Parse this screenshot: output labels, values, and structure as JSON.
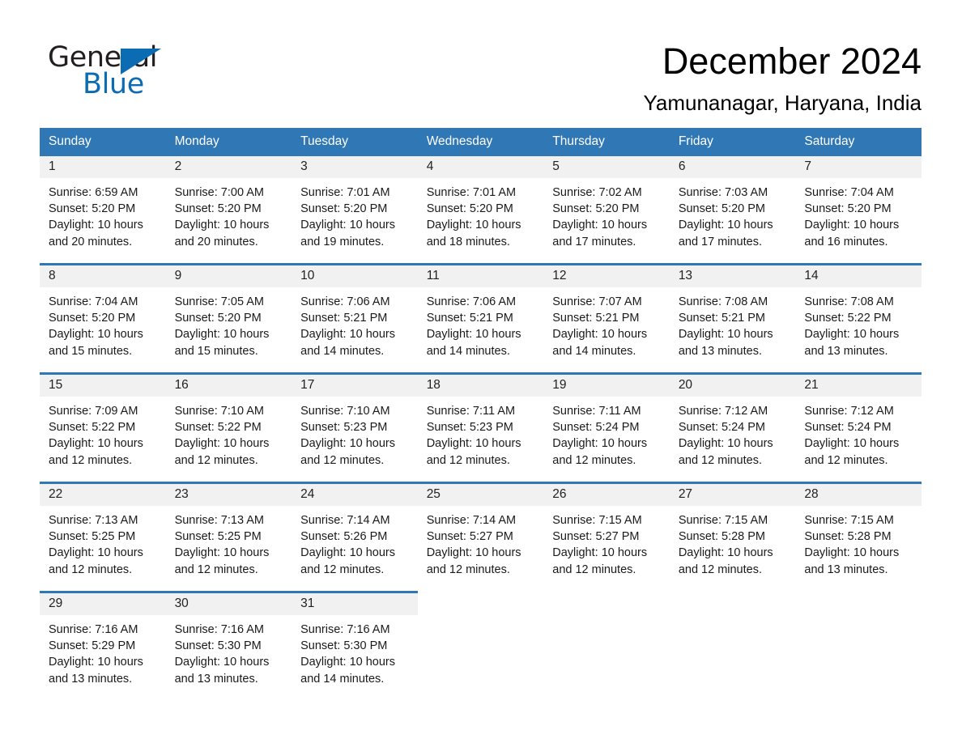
{
  "brand": {
    "name_part1": "General",
    "name_part2": "Blue",
    "accent_color": "#0b6cb3",
    "header_color": "#3077b5"
  },
  "header": {
    "month_title": "December 2024",
    "location": "Yamunanagar, Haryana, India"
  },
  "weekday_headers": [
    "Sunday",
    "Monday",
    "Tuesday",
    "Wednesday",
    "Thursday",
    "Friday",
    "Saturday"
  ],
  "weeks": [
    [
      {
        "day": "1",
        "sunrise": "Sunrise: 6:59 AM",
        "sunset": "Sunset: 5:20 PM",
        "daylight": "Daylight: 10 hours and 20 minutes."
      },
      {
        "day": "2",
        "sunrise": "Sunrise: 7:00 AM",
        "sunset": "Sunset: 5:20 PM",
        "daylight": "Daylight: 10 hours and 20 minutes."
      },
      {
        "day": "3",
        "sunrise": "Sunrise: 7:01 AM",
        "sunset": "Sunset: 5:20 PM",
        "daylight": "Daylight: 10 hours and 19 minutes."
      },
      {
        "day": "4",
        "sunrise": "Sunrise: 7:01 AM",
        "sunset": "Sunset: 5:20 PM",
        "daylight": "Daylight: 10 hours and 18 minutes."
      },
      {
        "day": "5",
        "sunrise": "Sunrise: 7:02 AM",
        "sunset": "Sunset: 5:20 PM",
        "daylight": "Daylight: 10 hours and 17 minutes."
      },
      {
        "day": "6",
        "sunrise": "Sunrise: 7:03 AM",
        "sunset": "Sunset: 5:20 PM",
        "daylight": "Daylight: 10 hours and 17 minutes."
      },
      {
        "day": "7",
        "sunrise": "Sunrise: 7:04 AM",
        "sunset": "Sunset: 5:20 PM",
        "daylight": "Daylight: 10 hours and 16 minutes."
      }
    ],
    [
      {
        "day": "8",
        "sunrise": "Sunrise: 7:04 AM",
        "sunset": "Sunset: 5:20 PM",
        "daylight": "Daylight: 10 hours and 15 minutes."
      },
      {
        "day": "9",
        "sunrise": "Sunrise: 7:05 AM",
        "sunset": "Sunset: 5:20 PM",
        "daylight": "Daylight: 10 hours and 15 minutes."
      },
      {
        "day": "10",
        "sunrise": "Sunrise: 7:06 AM",
        "sunset": "Sunset: 5:21 PM",
        "daylight": "Daylight: 10 hours and 14 minutes."
      },
      {
        "day": "11",
        "sunrise": "Sunrise: 7:06 AM",
        "sunset": "Sunset: 5:21 PM",
        "daylight": "Daylight: 10 hours and 14 minutes."
      },
      {
        "day": "12",
        "sunrise": "Sunrise: 7:07 AM",
        "sunset": "Sunset: 5:21 PM",
        "daylight": "Daylight: 10 hours and 14 minutes."
      },
      {
        "day": "13",
        "sunrise": "Sunrise: 7:08 AM",
        "sunset": "Sunset: 5:21 PM",
        "daylight": "Daylight: 10 hours and 13 minutes."
      },
      {
        "day": "14",
        "sunrise": "Sunrise: 7:08 AM",
        "sunset": "Sunset: 5:22 PM",
        "daylight": "Daylight: 10 hours and 13 minutes."
      }
    ],
    [
      {
        "day": "15",
        "sunrise": "Sunrise: 7:09 AM",
        "sunset": "Sunset: 5:22 PM",
        "daylight": "Daylight: 10 hours and 12 minutes."
      },
      {
        "day": "16",
        "sunrise": "Sunrise: 7:10 AM",
        "sunset": "Sunset: 5:22 PM",
        "daylight": "Daylight: 10 hours and 12 minutes."
      },
      {
        "day": "17",
        "sunrise": "Sunrise: 7:10 AM",
        "sunset": "Sunset: 5:23 PM",
        "daylight": "Daylight: 10 hours and 12 minutes."
      },
      {
        "day": "18",
        "sunrise": "Sunrise: 7:11 AM",
        "sunset": "Sunset: 5:23 PM",
        "daylight": "Daylight: 10 hours and 12 minutes."
      },
      {
        "day": "19",
        "sunrise": "Sunrise: 7:11 AM",
        "sunset": "Sunset: 5:24 PM",
        "daylight": "Daylight: 10 hours and 12 minutes."
      },
      {
        "day": "20",
        "sunrise": "Sunrise: 7:12 AM",
        "sunset": "Sunset: 5:24 PM",
        "daylight": "Daylight: 10 hours and 12 minutes."
      },
      {
        "day": "21",
        "sunrise": "Sunrise: 7:12 AM",
        "sunset": "Sunset: 5:24 PM",
        "daylight": "Daylight: 10 hours and 12 minutes."
      }
    ],
    [
      {
        "day": "22",
        "sunrise": "Sunrise: 7:13 AM",
        "sunset": "Sunset: 5:25 PM",
        "daylight": "Daylight: 10 hours and 12 minutes."
      },
      {
        "day": "23",
        "sunrise": "Sunrise: 7:13 AM",
        "sunset": "Sunset: 5:25 PM",
        "daylight": "Daylight: 10 hours and 12 minutes."
      },
      {
        "day": "24",
        "sunrise": "Sunrise: 7:14 AM",
        "sunset": "Sunset: 5:26 PM",
        "daylight": "Daylight: 10 hours and 12 minutes."
      },
      {
        "day": "25",
        "sunrise": "Sunrise: 7:14 AM",
        "sunset": "Sunset: 5:27 PM",
        "daylight": "Daylight: 10 hours and 12 minutes."
      },
      {
        "day": "26",
        "sunrise": "Sunrise: 7:15 AM",
        "sunset": "Sunset: 5:27 PM",
        "daylight": "Daylight: 10 hours and 12 minutes."
      },
      {
        "day": "27",
        "sunrise": "Sunrise: 7:15 AM",
        "sunset": "Sunset: 5:28 PM",
        "daylight": "Daylight: 10 hours and 12 minutes."
      },
      {
        "day": "28",
        "sunrise": "Sunrise: 7:15 AM",
        "sunset": "Sunset: 5:28 PM",
        "daylight": "Daylight: 10 hours and 13 minutes."
      }
    ],
    [
      {
        "day": "29",
        "sunrise": "Sunrise: 7:16 AM",
        "sunset": "Sunset: 5:29 PM",
        "daylight": "Daylight: 10 hours and 13 minutes."
      },
      {
        "day": "30",
        "sunrise": "Sunrise: 7:16 AM",
        "sunset": "Sunset: 5:30 PM",
        "daylight": "Daylight: 10 hours and 13 minutes."
      },
      {
        "day": "31",
        "sunrise": "Sunrise: 7:16 AM",
        "sunset": "Sunset: 5:30 PM",
        "daylight": "Daylight: 10 hours and 14 minutes."
      },
      {
        "day": "",
        "sunrise": "",
        "sunset": "",
        "daylight": ""
      },
      {
        "day": "",
        "sunrise": "",
        "sunset": "",
        "daylight": ""
      },
      {
        "day": "",
        "sunrise": "",
        "sunset": "",
        "daylight": ""
      },
      {
        "day": "",
        "sunrise": "",
        "sunset": "",
        "daylight": ""
      }
    ]
  ]
}
